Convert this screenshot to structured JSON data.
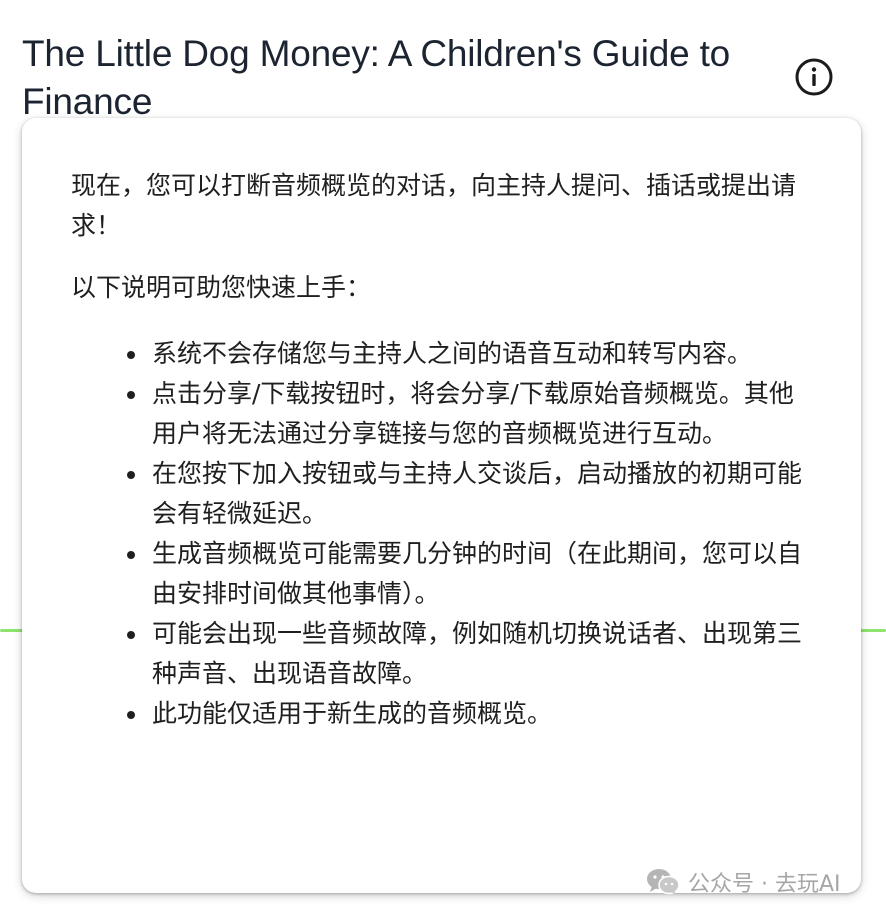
{
  "header": {
    "title": "The Little Dog Money: A Children's Guide to Finance",
    "info_icon": "info-icon"
  },
  "popover": {
    "intro": "现在，您可以打断音频概览的对话，向主持人提问、插话或提出请求！",
    "lead": "以下说明可助您快速上手：",
    "items": [
      "系统不会存储您与主持人之间的语音互动和转写内容。",
      "点击分享/下载按钮时，将会分享/下载原始音频概览。其他用户将无法通过分享链接与您的音频概览进行互动。",
      "在您按下加入按钮或与主持人交谈后，启动播放的初期可能会有轻微延迟。",
      "生成音频概览可能需要几分钟的时间（在此期间，您可以自由安排时间做其他事情）。",
      "可能会出现一些音频故障，例如随机切换说话者、出现第三种声音、出现语音故障。",
      "此功能仅适用于新生成的音频概览。"
    ]
  },
  "watermark": {
    "icon": "wechat-icon",
    "text": "公众号 · 去玩AI"
  },
  "colors": {
    "title": "#1b2430",
    "body_text": "#1f1f1f",
    "waveform": "#8fe36f",
    "watermark": "#a6a6a6"
  }
}
